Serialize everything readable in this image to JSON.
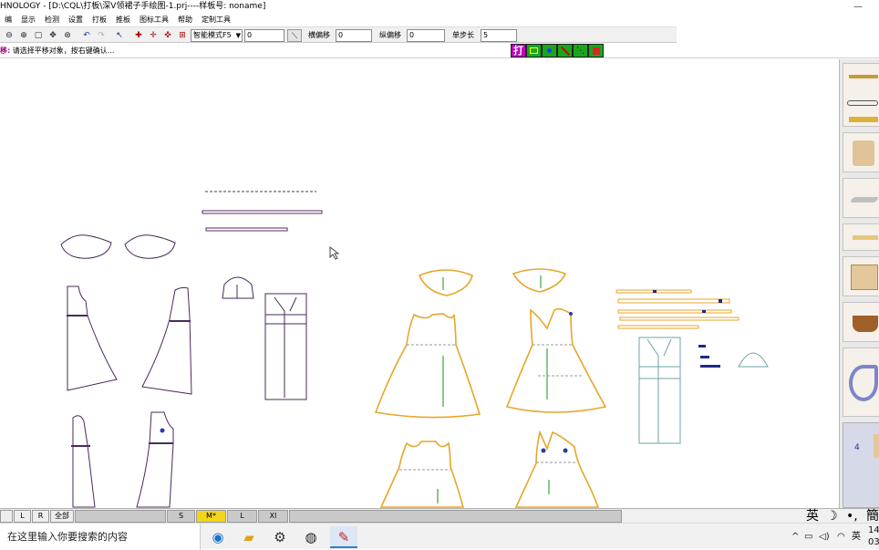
{
  "title_bar": {
    "text": "HNOLOGY - [D:\\CQL\\打板\\深V领裙子手绘图-1.prj----样板号: noname]"
  },
  "menu": [
    "编",
    "显示",
    "检测",
    "设置",
    "打板",
    "推板",
    "图标工具",
    "帮助",
    "定制工具"
  ],
  "toolbar": {
    "mode_select": "智能模式F5",
    "value_input": "0",
    "h_offset_label": "横偏移",
    "h_offset_value": "0",
    "v_offset_label": "纵偏移",
    "v_offset_value": "0",
    "step_label": "单步长",
    "step_value": "5"
  },
  "status": {
    "prefix": "移:",
    "prompt": "请选择平移对象，按右键确认..."
  },
  "mode_buttons": {
    "first_label": "打"
  },
  "bottom_bar": {
    "left": [
      "L",
      "R",
      "全部"
    ],
    "sizes": [
      "S",
      "M*",
      "L",
      "Xl"
    ]
  },
  "ime": {
    "lang": "英",
    "moon": "☽",
    "punct": "•,",
    "chs": "簡"
  },
  "taskbar": {
    "search_placeholder": "在这里输入你要搜索的内容",
    "tray_lang": "英",
    "clock_time": "14",
    "clock_date": "03-"
  },
  "colors": {
    "gold": "#e6a62a",
    "purple": "#5b2a66",
    "green": "#3aa63a",
    "teal": "#6fa3a6",
    "magenta": "#c000c0"
  },
  "icons": [
    "edge-icon",
    "file-explorer-icon",
    "settings-gear-icon",
    "media-app-icon",
    "cad-app-icon"
  ]
}
